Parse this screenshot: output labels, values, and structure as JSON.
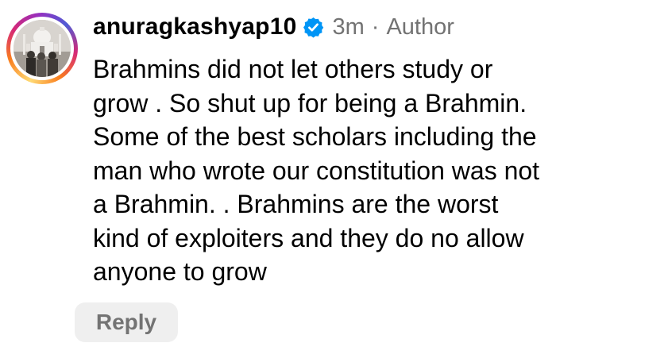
{
  "comment": {
    "username": "anuragkashyap10",
    "verified_icon": "verified-badge-icon",
    "time": "3m",
    "separator": "·",
    "role": "Author",
    "text_lines": [
      "Brahmins did not let others study or",
      "grow . So shut up for being a Brahmin.",
      "Some of the best scholars including the",
      "man who wrote our constitution was not",
      "a Brahmin. . Brahmins are the worst",
      "kind of exploiters and they do no allow",
      "anyone to grow"
    ],
    "reply_label": "Reply"
  },
  "colors": {
    "text": "#000000",
    "secondary_text": "#737373",
    "verified_blue": "#0095f6",
    "reply_background": "#efefef"
  }
}
